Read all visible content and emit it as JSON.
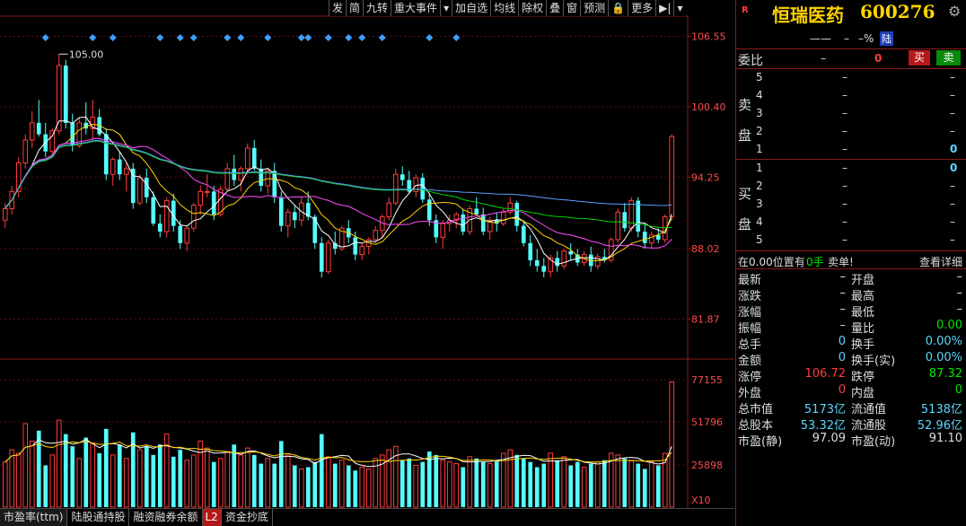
{
  "toolbar": {
    "items": [
      "发",
      "简",
      "九转",
      "重大事件",
      "▾",
      "加自选",
      "均线",
      "除权",
      "叠",
      "窗",
      "预测",
      "🔒",
      "更多",
      "▶|",
      "▾"
    ]
  },
  "stock": {
    "badge": "R",
    "name": "恒瑞医药",
    "code": "600276",
    "sub_price": "——",
    "sub_change": "–",
    "sub_pct": "–%",
    "market_tag": "陆"
  },
  "order_book": {
    "weibi_label": "委比",
    "weibi_val": "–",
    "weibi_num": "0",
    "buy_btn": "买",
    "sell_btn": "卖",
    "sell_label": "卖盘",
    "buy_label": "买盘",
    "sell_levels": [
      {
        "n": "5",
        "p": "–",
        "v": "–"
      },
      {
        "n": "4",
        "p": "–",
        "v": "–"
      },
      {
        "n": "3",
        "p": "–",
        "v": "–"
      },
      {
        "n": "2",
        "p": "–",
        "v": "–"
      },
      {
        "n": "1",
        "p": "–",
        "v": "0"
      }
    ],
    "buy_levels": [
      {
        "n": "1",
        "p": "–",
        "v": "0"
      },
      {
        "n": "2",
        "p": "–",
        "v": "–"
      },
      {
        "n": "3",
        "p": "–",
        "v": "–"
      },
      {
        "n": "4",
        "p": "–",
        "v": "–"
      },
      {
        "n": "5",
        "p": "–",
        "v": "–"
      }
    ],
    "position_line": "在0.00位置有",
    "position_qty": "0手",
    "position_side": "卖单!",
    "detail_link": "查看详细"
  },
  "stats": [
    {
      "l": "最新",
      "v": "–",
      "l2": "开盘",
      "v2": "–",
      "c": "white",
      "c2": "white"
    },
    {
      "l": "涨跌",
      "v": "–",
      "l2": "最高",
      "v2": "–",
      "c": "white",
      "c2": "white"
    },
    {
      "l": "涨幅",
      "v": "–",
      "l2": "最低",
      "v2": "–",
      "c": "white",
      "c2": "white"
    },
    {
      "l": "振幅",
      "v": "–",
      "l2": "量比",
      "v2": "0.00",
      "c": "white",
      "c2": "green"
    },
    {
      "l": "总手",
      "v": "0",
      "l2": "换手",
      "v2": "0.00%",
      "c": "cyan",
      "c2": "cyan"
    },
    {
      "l": "金额",
      "v": "0",
      "l2": "换手(实)",
      "v2": "0.00%",
      "c": "cyan",
      "c2": "cyan"
    },
    {
      "l": "涨停",
      "v": "106.72",
      "l2": "跌停",
      "v2": "87.32",
      "c": "red",
      "c2": "green"
    },
    {
      "l": "外盘",
      "v": "0",
      "l2": "内盘",
      "v2": "0",
      "c": "red",
      "c2": "green"
    },
    {
      "l": "总市值",
      "v": "5173亿",
      "l2": "流通值",
      "v2": "5138亿",
      "c": "cyan",
      "c2": "cyan"
    },
    {
      "l": "总股本",
      "v": "53.32亿",
      "l2": "流通股",
      "v2": "52.96亿",
      "c": "cyan",
      "c2": "cyan"
    },
    {
      "l": "市盈(静)",
      "v": "97.09",
      "l2": "市盈(动)",
      "v2": "91.10",
      "c": "white",
      "c2": "white"
    }
  ],
  "price_axis": [
    "106.55",
    "100.40",
    "94.25",
    "88.02",
    "81.87"
  ],
  "vol_axis": [
    "77155",
    "51796",
    "25898",
    "X10"
  ],
  "high_marker": "105.00",
  "bottom_tabs": [
    "市盈率(ttm)",
    "陆股通持股",
    "融资融券余额",
    "L2",
    "资金抄底"
  ],
  "colors": {
    "up": "#ff3c3c",
    "down": "#54ffff",
    "ma5": "#ffffff",
    "ma10": "#ffd400",
    "ma20": "#ff4cff",
    "ma60": "#00d400",
    "ma120": "#5aa0ff"
  },
  "chart_data": {
    "type": "candlestick",
    "price_ylim": [
      79,
      108
    ],
    "vol_ylim": [
      0,
      80000
    ],
    "candles": [
      [
        90.5,
        92.0,
        89.8,
        91.5
      ],
      [
        91.5,
        93.5,
        91.0,
        93.0
      ],
      [
        93.0,
        96.0,
        92.5,
        95.5
      ],
      [
        95.5,
        98.0,
        95.0,
        97.5
      ],
      [
        97.5,
        100.0,
        96.8,
        99.0
      ],
      [
        99.0,
        101.0,
        97.8,
        98.0
      ],
      [
        98.0,
        99.0,
        96.0,
        96.5
      ],
      [
        96.5,
        98.5,
        96.0,
        98.3
      ],
      [
        98.3,
        105.0,
        98.0,
        104.0
      ],
      [
        104.0,
        104.5,
        98.5,
        99.0
      ],
      [
        99.0,
        99.8,
        96.5,
        97.0
      ],
      [
        97.0,
        99.5,
        96.8,
        99.0
      ],
      [
        99.0,
        100.8,
        98.0,
        98.5
      ],
      [
        98.5,
        101.0,
        97.5,
        99.5
      ],
      [
        99.5,
        100.2,
        97.8,
        98.0
      ],
      [
        98.0,
        98.5,
        94.0,
        94.5
      ],
      [
        94.5,
        96.0,
        93.5,
        95.8
      ],
      [
        95.8,
        96.5,
        94.0,
        94.5
      ],
      [
        94.5,
        95.5,
        93.0,
        95.0
      ],
      [
        95.0,
        95.5,
        91.5,
        92.0
      ],
      [
        92.0,
        94.5,
        91.8,
        94.2
      ],
      [
        94.2,
        95.0,
        92.0,
        92.5
      ],
      [
        92.5,
        93.0,
        90.0,
        90.2
      ],
      [
        90.2,
        91.0,
        89.0,
        89.5
      ],
      [
        89.5,
        92.5,
        89.0,
        92.2
      ],
      [
        92.2,
        92.8,
        89.5,
        90.0
      ],
      [
        90.0,
        90.5,
        88.0,
        88.5
      ],
      [
        88.5,
        90.0,
        87.8,
        89.8
      ],
      [
        89.8,
        92.0,
        89.5,
        91.8
      ],
      [
        91.8,
        93.5,
        91.0,
        93.0
      ],
      [
        93.0,
        94.5,
        92.5,
        93.0
      ],
      [
        93.0,
        93.5,
        90.5,
        91.0
      ],
      [
        91.0,
        93.5,
        90.8,
        93.2
      ],
      [
        93.2,
        95.5,
        93.0,
        95.0
      ],
      [
        95.0,
        96.2,
        93.5,
        94.0
      ],
      [
        94.0,
        95.2,
        93.0,
        95.0
      ],
      [
        95.0,
        97.2,
        94.5,
        96.8
      ],
      [
        96.8,
        97.5,
        94.8,
        95.0
      ],
      [
        95.0,
        95.8,
        93.0,
        93.5
      ],
      [
        93.5,
        95.0,
        92.8,
        94.8
      ],
      [
        94.8,
        95.5,
        92.0,
        92.5
      ],
      [
        92.5,
        93.0,
        89.5,
        90.0
      ],
      [
        90.0,
        91.5,
        89.0,
        91.2
      ],
      [
        91.2,
        91.8,
        89.8,
        90.5
      ],
      [
        90.5,
        92.5,
        90.0,
        92.0
      ],
      [
        92.0,
        93.0,
        90.5,
        90.8
      ],
      [
        90.8,
        91.0,
        88.0,
        88.5
      ],
      [
        88.5,
        89.0,
        85.5,
        86.0
      ],
      [
        86.0,
        88.8,
        85.8,
        88.5
      ],
      [
        88.5,
        89.5,
        87.5,
        88.0
      ],
      [
        88.0,
        90.0,
        87.8,
        89.8
      ],
      [
        89.8,
        90.5,
        88.5,
        89.0
      ],
      [
        89.0,
        89.5,
        87.0,
        87.5
      ],
      [
        87.5,
        88.5,
        87.0,
        88.2
      ],
      [
        88.2,
        89.0,
        87.5,
        88.8
      ],
      [
        88.8,
        90.0,
        88.5,
        89.6
      ],
      [
        89.6,
        91.0,
        89.0,
        90.8
      ],
      [
        90.8,
        92.5,
        90.5,
        92.0
      ],
      [
        92.0,
        95.0,
        91.8,
        94.5
      ],
      [
        94.5,
        95.2,
        93.5,
        94.0
      ],
      [
        94.0,
        94.8,
        92.8,
        93.0
      ],
      [
        93.0,
        94.5,
        92.5,
        94.2
      ],
      [
        94.2,
        94.6,
        92.0,
        92.3
      ],
      [
        92.3,
        92.8,
        90.0,
        90.5
      ],
      [
        90.5,
        91.0,
        88.5,
        89.0
      ],
      [
        89.0,
        90.5,
        88.0,
        90.2
      ],
      [
        90.2,
        91.0,
        89.5,
        90.5
      ],
      [
        90.5,
        91.2,
        89.8,
        91.0
      ],
      [
        91.0,
        91.5,
        89.2,
        89.5
      ],
      [
        89.5,
        91.8,
        89.2,
        91.5
      ],
      [
        91.5,
        92.5,
        91.0,
        91.0
      ],
      [
        91.0,
        91.6,
        89.2,
        89.5
      ],
      [
        89.5,
        90.8,
        88.8,
        90.5
      ],
      [
        90.5,
        91.2,
        89.5,
        90.2
      ],
      [
        90.2,
        91.5,
        90.0,
        91.2
      ],
      [
        91.2,
        92.5,
        91.0,
        92.0
      ],
      [
        92.0,
        92.2,
        89.5,
        90.0
      ],
      [
        90.0,
        90.5,
        88.2,
        88.5
      ],
      [
        88.5,
        89.2,
        86.5,
        87.0
      ],
      [
        87.0,
        88.0,
        86.0,
        86.5
      ],
      [
        86.5,
        87.2,
        85.5,
        86.0
      ],
      [
        86.0,
        87.5,
        85.5,
        87.2
      ],
      [
        87.2,
        87.8,
        86.0,
        86.5
      ],
      [
        86.5,
        88.0,
        86.2,
        87.8
      ],
      [
        87.8,
        88.5,
        87.0,
        87.5
      ],
      [
        87.5,
        88.0,
        86.5,
        86.8
      ],
      [
        86.8,
        87.8,
        86.5,
        87.5
      ],
      [
        87.5,
        88.2,
        86.0,
        86.5
      ],
      [
        86.5,
        87.6,
        86.2,
        87.3
      ],
      [
        87.3,
        88.0,
        86.8,
        87.0
      ],
      [
        87.0,
        89.0,
        86.8,
        88.8
      ],
      [
        88.8,
        91.5,
        88.5,
        91.2
      ],
      [
        91.2,
        92.0,
        89.5,
        89.8
      ],
      [
        89.8,
        92.5,
        89.5,
        92.2
      ],
      [
        92.2,
        92.5,
        89.0,
        89.5
      ],
      [
        89.5,
        90.2,
        88.0,
        88.5
      ],
      [
        88.5,
        89.5,
        88.0,
        89.2
      ],
      [
        89.2,
        89.8,
        88.5,
        88.8
      ],
      [
        88.8,
        91.0,
        88.5,
        90.8
      ],
      [
        90.8,
        98.0,
        90.5,
        97.8
      ]
    ],
    "volume": [
      26,
      33,
      31,
      48,
      38,
      44,
      24,
      30,
      50,
      42,
      35,
      28,
      40,
      37,
      31,
      45,
      30,
      36,
      28,
      43,
      33,
      35,
      30,
      36,
      42,
      29,
      33,
      27,
      30,
      38,
      34,
      26,
      28,
      32,
      36,
      30,
      34,
      30,
      25,
      28,
      25,
      38,
      30,
      24,
      22,
      23,
      26,
      42,
      29,
      25,
      27,
      24,
      21,
      23,
      22,
      28,
      30,
      33,
      35,
      27,
      28,
      24,
      26,
      32,
      30,
      27,
      26,
      25,
      23,
      29,
      28,
      26,
      25,
      27,
      31,
      33,
      30,
      28,
      26,
      23,
      25,
      31,
      27,
      29,
      24,
      26,
      23,
      25,
      26,
      27,
      31,
      30,
      28,
      27,
      25,
      22,
      26,
      24,
      31,
      72
    ],
    "ma_windows": [
      5,
      10,
      20,
      60,
      120
    ],
    "event_markers": [
      6,
      13,
      16,
      23,
      26,
      28,
      33,
      35,
      39,
      44,
      45,
      48,
      51,
      53,
      56,
      63,
      67
    ]
  }
}
